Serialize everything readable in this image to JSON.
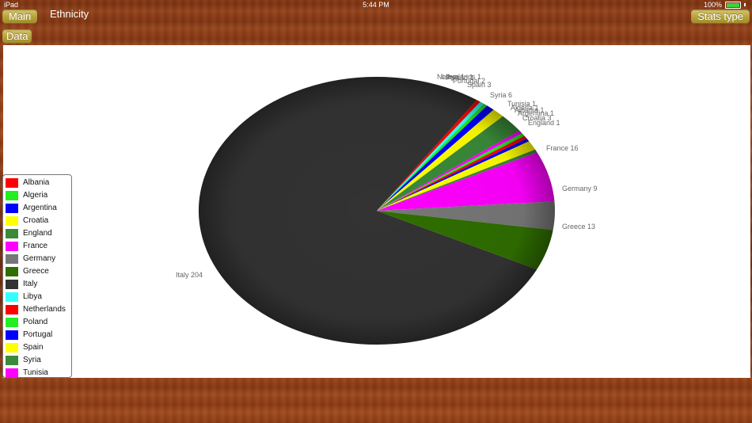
{
  "status_bar": {
    "device": "iPad",
    "time": "5:44 PM",
    "battery": "100%"
  },
  "toolbar": {
    "main_label": "Main",
    "title": "Ethnicity",
    "stats_type_label": "Stats type",
    "data_label": "Data"
  },
  "chart_data": {
    "type": "pie",
    "title": "",
    "categories": [
      "Italy",
      "Netherlands",
      "Libya",
      "Poland",
      "Portugal",
      "Spain",
      "Syria",
      "Tunisia",
      "Algeria",
      "Albania",
      "Argentina",
      "Croatia",
      "England",
      "France",
      "Germany",
      "Greece"
    ],
    "values": [
      204,
      1,
      1,
      1,
      2,
      3,
      6,
      1,
      1,
      1,
      1,
      3,
      1,
      16,
      9,
      13
    ],
    "slice_labels": [
      "Italy 204",
      "Netherlands 1",
      "Libya 1",
      "Poland 1",
      "Portugal 2",
      "Spain 3",
      "Syria 6",
      "Tunisia 1",
      "Algeria 1",
      "Albania 1",
      "Argentina 1",
      "Croatia 3",
      "England 1",
      "France 16",
      "Germany 9",
      "Greece 13"
    ],
    "colors": {
      "Albania": "#ff0000",
      "Algeria": "#22ee22",
      "Argentina": "#0000ff",
      "Croatia": "#ffff00",
      "England": "#3a8a3a",
      "France": "#ff00ff",
      "Germany": "#777777",
      "Greece": "#2f6e00",
      "Italy": "#333333",
      "Libya": "#33ffff",
      "Netherlands": "#ff0000",
      "Poland": "#22ee22",
      "Portugal": "#0000ff",
      "Spain": "#ffff00",
      "Syria": "#3a8a3a",
      "Tunisia": "#ff00ff"
    },
    "legend": {
      "placement": "left",
      "items": [
        "Albania",
        "Algeria",
        "Argentina",
        "Croatia",
        "England",
        "France",
        "Germany",
        "Greece",
        "Italy",
        "Libya",
        "Netherlands",
        "Poland",
        "Portugal",
        "Spain",
        "Syria",
        "Tunisia"
      ]
    }
  }
}
